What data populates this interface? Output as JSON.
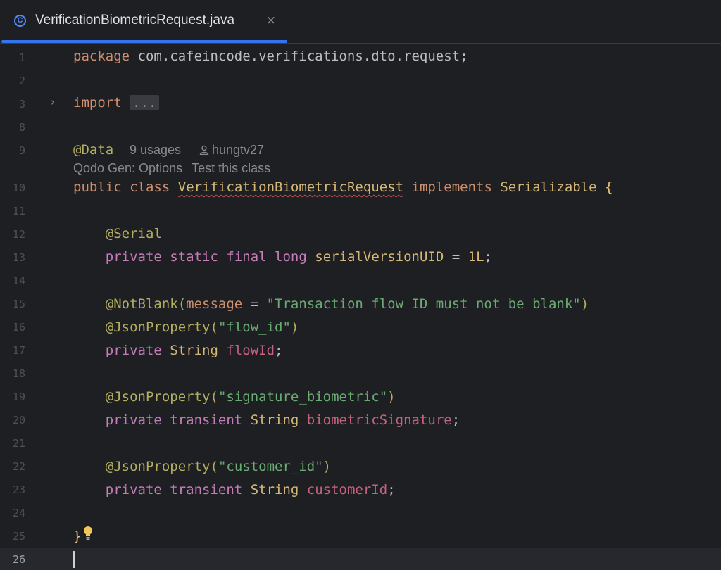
{
  "tab": {
    "icon": "class-icon",
    "icon_glyph": "C",
    "title": "VerificationBiometricRequest.java",
    "close_glyph": "×"
  },
  "gutter": [
    "1",
    "2",
    "3",
    "8",
    "9",
    "10",
    "11",
    "12",
    "13",
    "14",
    "15",
    "16",
    "17",
    "18",
    "19",
    "20",
    "21",
    "22",
    "23",
    "24",
    "25",
    "26"
  ],
  "current_line": "26",
  "code": {
    "l1": {
      "kw": "package",
      "rest": " com.cafeincode.verifications.dto.request;"
    },
    "l3": {
      "kw": "import",
      "placeholder": "..."
    },
    "l9": {
      "annotation": "@Data"
    },
    "inlay_usages": "9 usages",
    "inlay_author": "hungtv27",
    "codelens_options": "Qodo Gen: Options",
    "codelens_test": "Test this class",
    "l10": {
      "kw1": "public",
      "kw2": "class",
      "name": "VerificationBiometricRequest",
      "kw3": "implements",
      "iface": "Serializable",
      "brace": "{"
    },
    "l12": {
      "annotation": "@Serial"
    },
    "l13": {
      "kw1": "private",
      "kw2": "static",
      "kw3": "final",
      "kw4": "long",
      "field": "serialVersionUID",
      "eq": " = ",
      "num": "1L",
      "semi": ";"
    },
    "l15": {
      "annotation": "@NotBlank",
      "open": "(",
      "param": "message",
      "eq": " = ",
      "str": "\"Transaction flow ID must not be blank\"",
      "close": ")"
    },
    "l16": {
      "annotation": "@JsonProperty",
      "open": "(",
      "str": "\"flow_id\"",
      "close": ")"
    },
    "l17": {
      "kw1": "private",
      "type": "String",
      "field": "flowId",
      "semi": ";"
    },
    "l19": {
      "annotation": "@JsonProperty",
      "open": "(",
      "str": "\"signature_biometric\"",
      "close": ")"
    },
    "l20": {
      "kw1": "private",
      "kw2": "transient",
      "type": "String",
      "field": "biometricSignature",
      "semi": ";"
    },
    "l22": {
      "annotation": "@JsonProperty",
      "open": "(",
      "str": "\"customer_id\"",
      "close": ")"
    },
    "l23": {
      "kw1": "private",
      "kw2": "transient",
      "type": "String",
      "field": "customerId",
      "semi": ";"
    },
    "l25": {
      "brace": "}"
    }
  },
  "colors": {
    "background": "#1e1f22",
    "keyword": "#cf8e6d",
    "annotation": "#b3ae60",
    "string": "#6aab73",
    "field": "#c7617d",
    "accent": "#3574f0"
  }
}
